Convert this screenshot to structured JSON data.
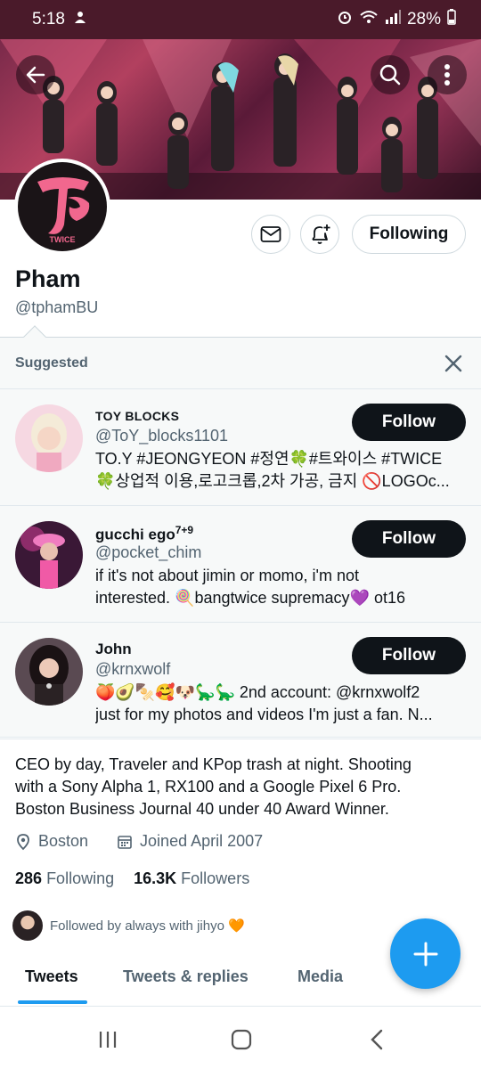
{
  "status_bar": {
    "time": "5:18",
    "battery": "28%"
  },
  "header": {
    "back_icon": "arrow-left-icon",
    "search_icon": "search-icon",
    "more_icon": "more-vertical-icon"
  },
  "profile": {
    "avatar_text": "TWICE",
    "display_name": "Pham",
    "handle": "@tphamBU",
    "following_button": "Following",
    "bio_lines": [
      "CEO by day, Traveler and KPop trash at night. Shooting",
      "with a Sony Alpha 1, RX100 and a Google Pixel 6 Pro.",
      "Boston Business Journal 40 under 40 Award Winner."
    ],
    "location": "Boston",
    "joined": "Joined April 2007",
    "following_count": "286",
    "following_label": "Following",
    "followers_count": "16.3K",
    "followers_label": "Followers",
    "followed_by": "Followed by always with jihyo 🧡"
  },
  "suggested": {
    "title": "Suggested",
    "items": [
      {
        "name": "TOY BLOCKS",
        "handle": "@ToY_blocks1101",
        "bio_line1": "TO.Y #JEONGYEON #정연🍀#트와이스 #TWICE",
        "bio_line2": "🍀상업적 이용,로고크롭,2차 가공, 금지 🚫LOGOc...",
        "follow_label": "Follow"
      },
      {
        "name": "gucchi ego",
        "name_sup": "7+9",
        "handle": "@pocket_chim",
        "bio_line1": "if it's not about jimin or momo, i'm not",
        "bio_line2": "interested. 🍭bangtwice supremacy💜 ot16",
        "follow_label": "Follow"
      },
      {
        "name": "John",
        "handle": "@krnxwolf",
        "bio_line1": "🍑🥑🍢🥰🐶🦕🦕 2nd account: @krnxwolf2",
        "bio_line2": "just for my photos and videos  I'm just a fan. N...",
        "follow_label": "Follow"
      }
    ]
  },
  "tabs": [
    "Tweets",
    "Tweets & replies",
    "Media"
  ],
  "colors": {
    "accent": "#1d9bf0",
    "dark_button": "#0f1419",
    "muted_text": "#536471"
  }
}
